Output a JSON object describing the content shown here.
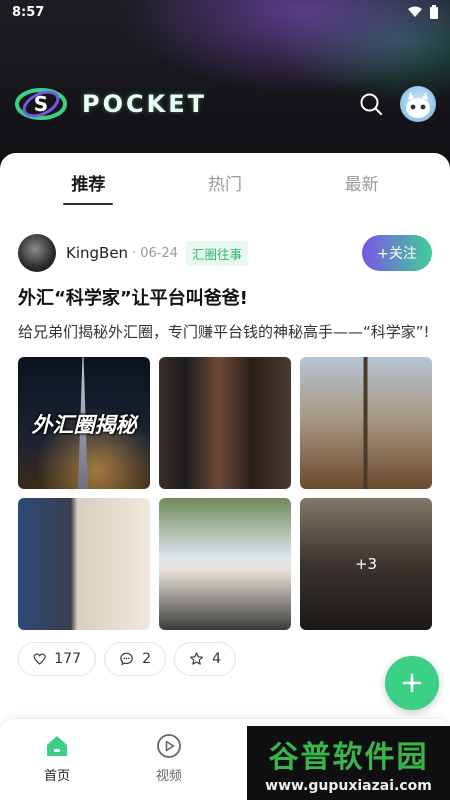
{
  "status_bar": {
    "time": "8:57"
  },
  "header": {
    "brand": "POCKET"
  },
  "tabs": [
    {
      "label": "推荐",
      "active": true
    },
    {
      "label": "热门",
      "active": false
    },
    {
      "label": "最新",
      "active": false
    }
  ],
  "post": {
    "author": "KingBen",
    "date": "06-24",
    "tag": "汇圈往事",
    "follow_label": "+关注",
    "title": "外汇“科学家”让平台叫爸爸!",
    "description": "给兄弟们揭秘外汇圈，专门赚平台钱的神秘高手——“科学家”!",
    "image_overlay_text": "外汇圈揭秘",
    "more_images_label": "+3",
    "likes": "177",
    "comments": "2",
    "favorites": "4"
  },
  "bottom_nav": [
    {
      "label": "首页",
      "icon": "home-icon",
      "active": true
    },
    {
      "label": "视频",
      "icon": "play-icon",
      "active": false
    }
  ],
  "watermark": {
    "cn": "谷普软件园",
    "en": "www.gupuxiazai.com"
  },
  "colors": {
    "accent_green": "#3ccf86",
    "tag_green": "#2bb673",
    "follow_gradient_start": "#7a56e6",
    "follow_gradient_end": "#3fcf9a"
  }
}
